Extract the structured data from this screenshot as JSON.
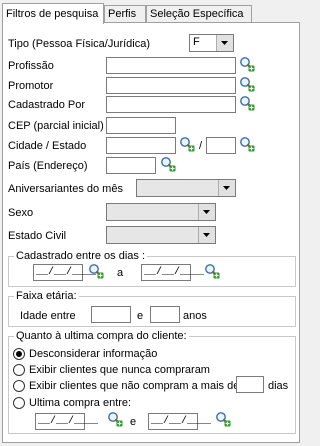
{
  "tabs": [
    "Filtros de pesquisa",
    "Perfis",
    "Seleção Específica"
  ],
  "fields": {
    "tipo_label": "Tipo (Pessoa Física/Jurídica)",
    "tipo_value": "F",
    "profissao_label": "Profissão",
    "promotor_label": "Promotor",
    "cadastrado_por_label": "Cadastrado Por",
    "cep_label": "CEP (parcial inicial)",
    "cidade_label": "Cidade / Estado",
    "cidade_sep": "/",
    "pais_label": "País (Endereço)",
    "aniversariantes_label": "Aniversariantes do mês",
    "sexo_label": "Sexo",
    "estado_civil_label": "Estado Civil"
  },
  "cadastrado": {
    "title": "Cadastrado entre os dias :",
    "start": "__/__/____",
    "conj": "a",
    "end": "__/__/____"
  },
  "faixa": {
    "title": "Faixa etária:",
    "prefix": "Idade entre",
    "conj": "e",
    "suffix": "anos"
  },
  "ultima": {
    "title": "Quanto à ultima compra do cliente:",
    "options": [
      "Desconsiderar informação",
      "Exibir clientes que nunca compraram",
      "Exibir clientes que não compram a mais de",
      "Ultima compra entre:"
    ],
    "selected": 0,
    "dias_suffix": "dias",
    "start": "__/__/____",
    "conj": "e",
    "end": "__/__/____"
  }
}
